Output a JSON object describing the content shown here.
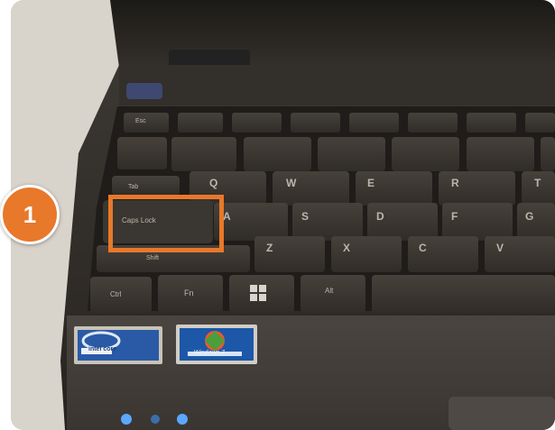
{
  "step": {
    "number": "1"
  },
  "keys": {
    "caps_lock": "Caps Lock",
    "letters": [
      "Q",
      "W",
      "E",
      "R",
      "T",
      "A",
      "S",
      "D",
      "F",
      "G",
      "Z",
      "X",
      "C",
      "V"
    ],
    "modifiers": [
      "Ctrl",
      "Fn",
      "Alt",
      "Tab",
      "Shift",
      "Esc"
    ]
  },
  "stickers": {
    "intel": "intel core",
    "windows": "Windows 7"
  },
  "colors": {
    "accent": "#e8782a",
    "keyboard": "#2b2824",
    "key": "#3a3631"
  }
}
